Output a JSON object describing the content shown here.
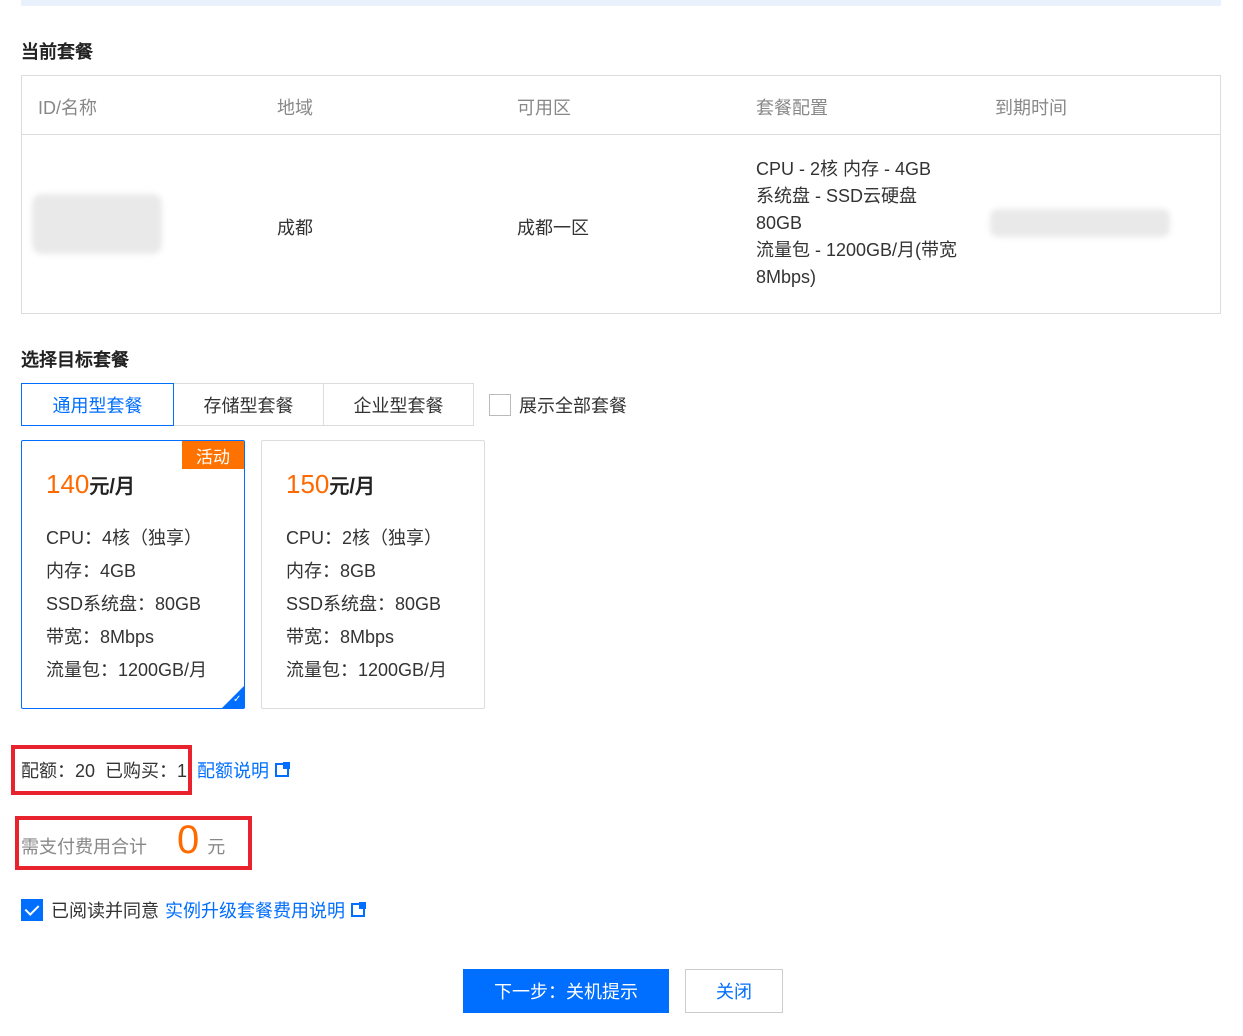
{
  "current": {
    "title": "当前套餐",
    "headers": [
      "ID/名称",
      "地域",
      "可用区",
      "套餐配置",
      "到期时间"
    ],
    "row": {
      "region": "成都",
      "zone": "成都一区",
      "spec_lines": [
        "CPU - 2核 内存 - 4GB",
        "系统盘 - SSD云硬盘",
        "80GB",
        "流量包 - 1200GB/月(带宽",
        "8Mbps)"
      ]
    }
  },
  "target": {
    "title": "选择目标套餐",
    "tabs": [
      "通用型套餐",
      "存储型套餐",
      "企业型套餐"
    ],
    "show_all_label": "展示全部套餐",
    "plans": [
      {
        "price": "140",
        "unit": "元/月",
        "badge": "活动",
        "specs": [
          "CPU：4核（独享）",
          "内存：4GB",
          "SSD系统盘：80GB",
          "带宽：8Mbps",
          "流量包：1200GB/月"
        ]
      },
      {
        "price": "150",
        "unit": "元/月",
        "specs": [
          "CPU：2核（独享）",
          "内存：8GB",
          "SSD系统盘：80GB",
          "带宽：8Mbps",
          "流量包：1200GB/月"
        ]
      }
    ]
  },
  "quota": {
    "label": "配额：20  已购买：1",
    "link": "配额说明"
  },
  "total": {
    "label": "需支付费用合计",
    "amount": "0",
    "unit": "元"
  },
  "agree": {
    "text": "已阅读并同意",
    "link": "实例升级套餐费用说明"
  },
  "buttons": {
    "next": "下一步：关机提示",
    "close": "关闭"
  },
  "colors": {
    "primary": "#006eff",
    "price": "#ff6a00",
    "badge": "#ff7200",
    "highlight_box": "#e8232d"
  }
}
